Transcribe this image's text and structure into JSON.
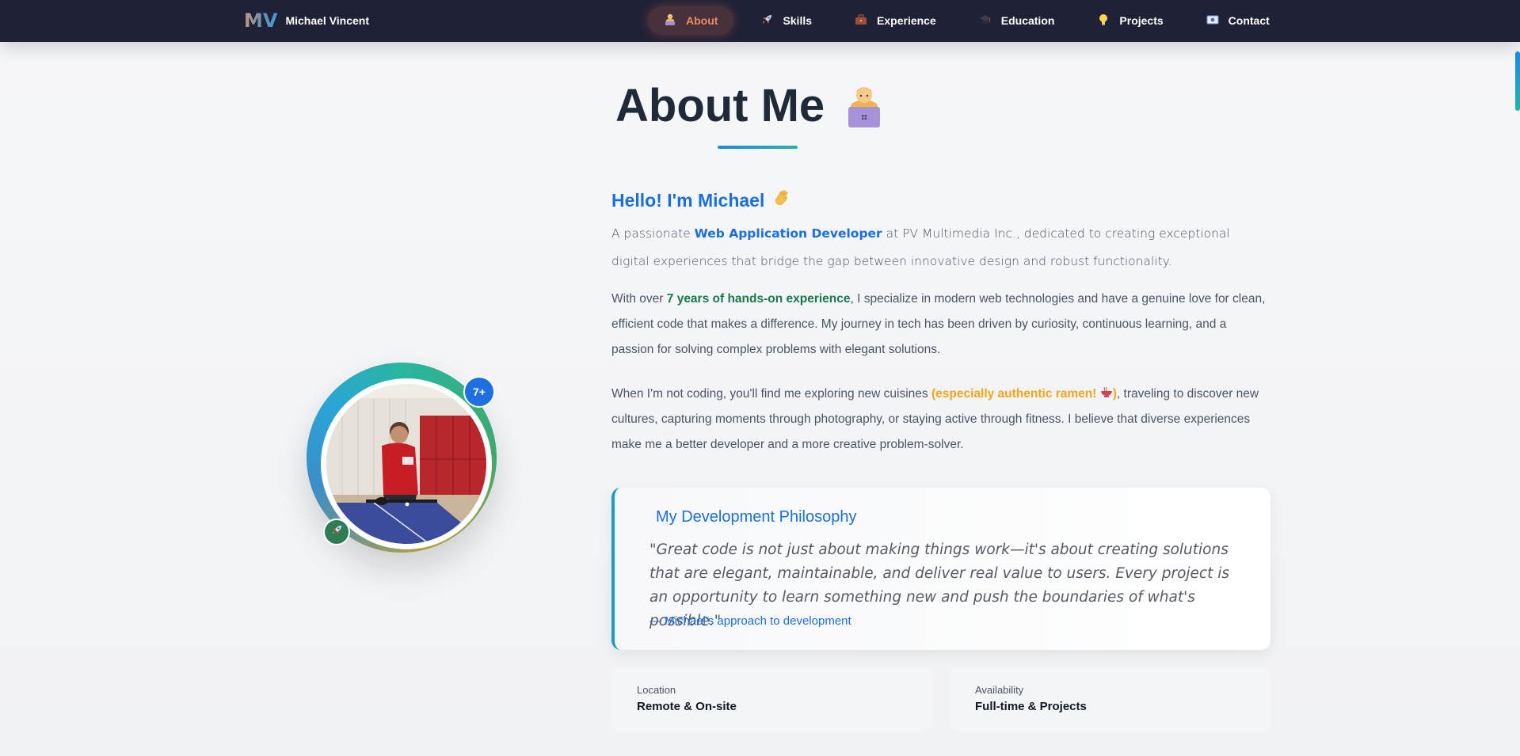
{
  "nav": {
    "brand_logo": "MV",
    "brand_name": "Michael Vincent",
    "items": [
      {
        "label": "About",
        "icon": "person-laptop-icon"
      },
      {
        "label": "Skills",
        "icon": "rocket-icon"
      },
      {
        "label": "Experience",
        "icon": "briefcase-icon"
      },
      {
        "label": "Education",
        "icon": "graduation-cap-icon"
      },
      {
        "label": "Projects",
        "icon": "lightbulb-icon"
      },
      {
        "label": "Contact",
        "icon": "envelope-icon"
      }
    ],
    "active": "About"
  },
  "about": {
    "title": "About Me",
    "hello": "Hello! I'm Michael",
    "p1_pre": "A passionate ",
    "p1_hl": "Web Application Developer",
    "p1_post": " at PV Multimedia Inc., dedicated to creating exceptional digital experiences that bridge the gap between innovative design and robust functionality.",
    "p2_pre": "With over ",
    "p2_hl": "7 years of hands-on experience",
    "p2_post": ", I specialize in modern web technologies and have a genuine love for clean, efficient code that makes a difference. My journey in tech has been driven by curiosity, continuous learning, and a passion for solving complex problems with elegant solutions.",
    "p3_pre": "When I'm not coding, you'll find me exploring new cuisines ",
    "p3_hl": "(especially authentic ramen! ",
    "p3_hl_close": ")",
    "p3_post": ", traveling to discover new cultures, capturing moments through photography, or staying active through fitness. I believe that diverse experiences make me a better developer and a more creative problem-solver."
  },
  "profile": {
    "badge_years": "7+",
    "badge_icon": "rocket-icon"
  },
  "philosophy": {
    "title": "My Development Philosophy",
    "quote": "\"Great code is not just about making things work—it's about creating solutions that are elegant, maintainable, and deliver real value to users. Every project is an opportunity to learn something new and push the boundaries of what's possible.\"",
    "author": "— Michael's approach to development"
  },
  "info": [
    {
      "label": "Location",
      "value": "Remote & On-site"
    },
    {
      "label": "Availability",
      "value": "Full-time & Projects"
    }
  ],
  "colors": {
    "nav_bg": "#1f2136",
    "accent_blue": "#1a6fe0",
    "accent_teal": "#26b3a6",
    "active_orange": "#f08a63",
    "highlight_green": "#177a4a",
    "highlight_orange": "#f2a51a"
  }
}
